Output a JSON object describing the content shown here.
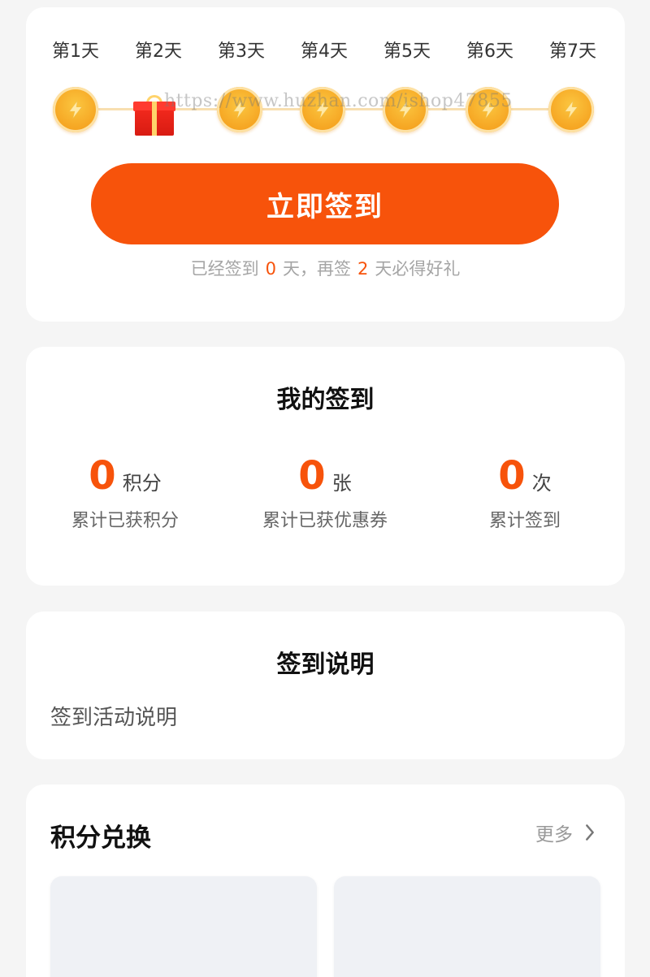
{
  "signin": {
    "days": [
      "第1天",
      "第2天",
      "第3天",
      "第4天",
      "第5天",
      "第6天",
      "第7天"
    ],
    "gift_day_index": 1,
    "watermark": "https://www.huzhan.com/ishop47855",
    "button_label": "立即签到",
    "tip_prefix": "已经签到",
    "signed_days": "0",
    "tip_middle": "天，再签",
    "remaining_days": "2",
    "tip_suffix": "天必得好礼"
  },
  "my_signin": {
    "title": "我的签到",
    "stats": [
      {
        "value": "0",
        "unit": "积分",
        "label": "累计已获积分"
      },
      {
        "value": "0",
        "unit": "张",
        "label": "累计已获优惠券"
      },
      {
        "value": "0",
        "unit": "次",
        "label": "累计签到"
      }
    ]
  },
  "rules": {
    "title": "签到说明",
    "text": "签到活动说明"
  },
  "exchange": {
    "title": "积分兑换",
    "more_label": "更多"
  },
  "colors": {
    "accent": "#f7530b",
    "coin": "#f6a623",
    "background": "#f5f5f5"
  }
}
